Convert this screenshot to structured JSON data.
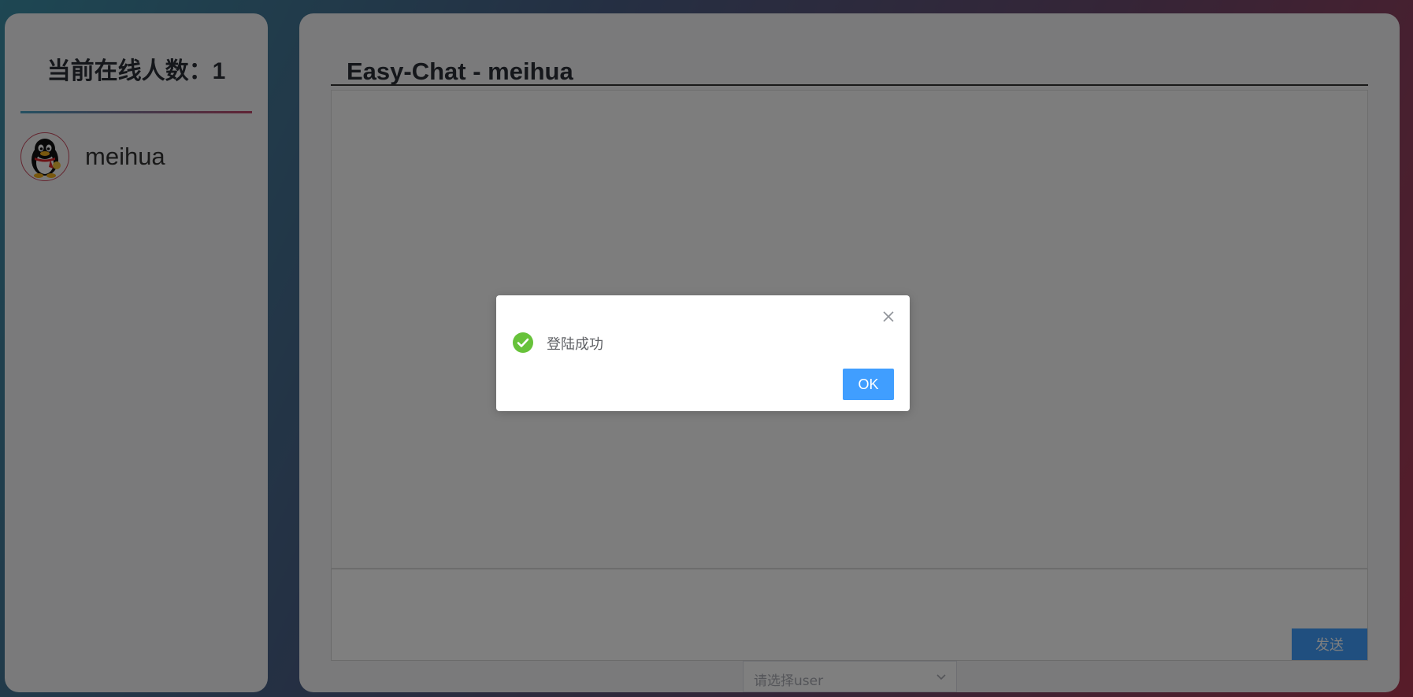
{
  "sidebar": {
    "online_label": "当前在线人数：",
    "online_count": "1",
    "users": [
      {
        "name": "meihua",
        "avatar_icon": "qq-penguin-icon"
      }
    ]
  },
  "chat": {
    "title": "Easy-Chat - meihua",
    "send_label": "发送",
    "select_placeholder": "请选择user"
  },
  "dialog": {
    "message": "登陆成功",
    "ok_label": "OK",
    "icon": "success-check-icon"
  },
  "colors": {
    "accent": "#409eff",
    "success": "#67c23a",
    "gradient_start": "#3c8ea6",
    "gradient_end": "#b03852"
  }
}
